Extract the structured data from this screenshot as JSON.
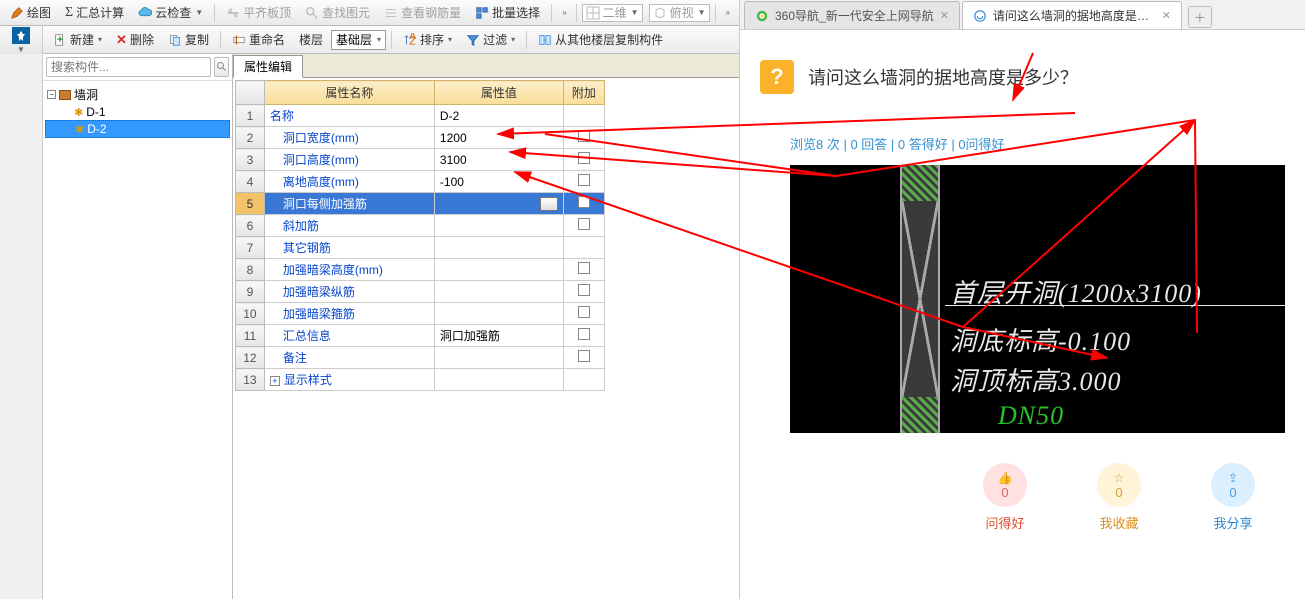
{
  "top_toolbar": {
    "draw": "绘图",
    "sum": "汇总计算",
    "cloud": "云检查",
    "flatten": "平齐板顶",
    "find_el": "查找图元",
    "rebar_qty": "查看钢筋量",
    "batch_sel": "批量选择",
    "view2d": "二维",
    "view_iso": "俯视"
  },
  "second_toolbar": {
    "new": "新建",
    "delete": "删除",
    "copy": "复制",
    "rename": "重命名",
    "floor": "楼层",
    "layer": "基础层",
    "sort": "排序",
    "filter": "过滤",
    "copy_from": "从其他楼层复制构件"
  },
  "search_placeholder": "搜索构件...",
  "tree": {
    "root": "墙洞",
    "items": [
      "D-1",
      "D-2"
    ],
    "selected": "D-2"
  },
  "prop_tab": "属性编辑",
  "prop_headers": {
    "name": "属性名称",
    "value": "属性值",
    "extra": "附加"
  },
  "prop_rows": [
    {
      "n": "1",
      "name": "名称",
      "value": "D-2",
      "chk": false,
      "sub": false
    },
    {
      "n": "2",
      "name": "洞口宽度(mm)",
      "value": "1200",
      "chk": true,
      "sub": true
    },
    {
      "n": "3",
      "name": "洞口高度(mm)",
      "value": "3100",
      "chk": true,
      "sub": true
    },
    {
      "n": "4",
      "name": "离地高度(mm)",
      "value": "-100",
      "chk": true,
      "sub": true
    },
    {
      "n": "5",
      "name": "洞口每侧加强筋",
      "value": "",
      "chk": true,
      "sub": true,
      "sel": true,
      "btn": true
    },
    {
      "n": "6",
      "name": "斜加筋",
      "value": "",
      "chk": true,
      "sub": true
    },
    {
      "n": "7",
      "name": "其它钢筋",
      "value": "",
      "chk": false,
      "sub": true
    },
    {
      "n": "8",
      "name": "加强暗梁高度(mm)",
      "value": "",
      "chk": true,
      "sub": true
    },
    {
      "n": "9",
      "name": "加强暗梁纵筋",
      "value": "",
      "chk": true,
      "sub": true
    },
    {
      "n": "10",
      "name": "加强暗梁箍筋",
      "value": "",
      "chk": true,
      "sub": true
    },
    {
      "n": "11",
      "name": "汇总信息",
      "value": "洞口加强筋",
      "chk": true,
      "sub": true
    },
    {
      "n": "12",
      "name": "备注",
      "value": "",
      "chk": true,
      "sub": true
    },
    {
      "n": "13",
      "name": "显示样式",
      "value": "",
      "chk": false,
      "sub": false,
      "exp": true
    }
  ],
  "browser": {
    "tab1": "360导航_新一代安全上网导航",
    "tab2": "请问这么墙洞的据地高度是多少？",
    "question_title": "请问这么墙洞的据地高度是多少？",
    "meta": "浏览8 次 | 0 回答 | 0 答得好 | 0问得好",
    "cad": {
      "line1": "首层开洞(1200x3100)",
      "line2": "洞底标高-0.100",
      "line3": "洞顶标高3.000",
      "line4": "DN50"
    },
    "actions": {
      "good_q": {
        "count": "0",
        "label": "问得好"
      },
      "fav": {
        "count": "0",
        "label": "我收藏"
      },
      "share": {
        "count": "0",
        "label": "我分享"
      }
    }
  }
}
